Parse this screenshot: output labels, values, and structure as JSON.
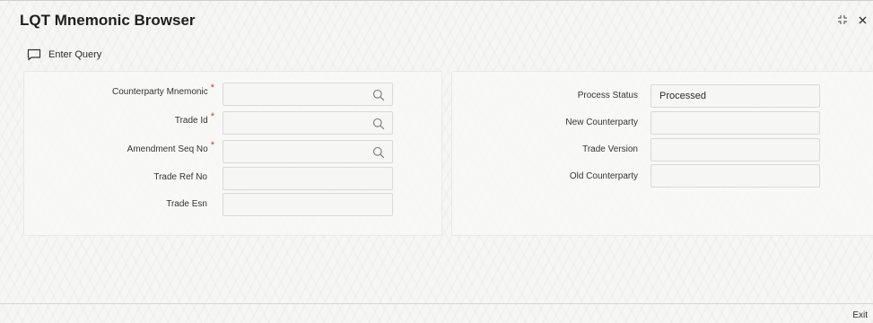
{
  "window": {
    "title": "LQT Mnemonic Browser"
  },
  "toolbar": {
    "enter_query_label": "Enter Query"
  },
  "left_panel": {
    "fields": [
      {
        "label": "Counterparty Mnemonic",
        "required": true,
        "value": "",
        "lookup": true
      },
      {
        "label": "Trade Id",
        "required": true,
        "value": "",
        "lookup": true
      },
      {
        "label": "Amendment Seq No",
        "required": true,
        "value": "",
        "lookup": true
      },
      {
        "label": "Trade Ref No",
        "required": false,
        "value": "",
        "lookup": false
      },
      {
        "label": "Trade Esn",
        "required": false,
        "value": "",
        "lookup": false
      }
    ]
  },
  "right_panel": {
    "fields": [
      {
        "label": "Process Status",
        "value": "Processed"
      },
      {
        "label": "New Counterparty",
        "value": ""
      },
      {
        "label": "Trade Version",
        "value": ""
      },
      {
        "label": "Old Counterparty",
        "value": ""
      }
    ]
  },
  "footer": {
    "exit_label": "Exit"
  },
  "required_marker": "*",
  "icons": {
    "query": "chat-bubble-icon",
    "lookup": "search-icon",
    "maximize": "maximize-icon",
    "close": "close-icon"
  },
  "colors": {
    "required": "#d33b3b",
    "border": "#d9d9d9",
    "background": "#f6f6f5"
  }
}
